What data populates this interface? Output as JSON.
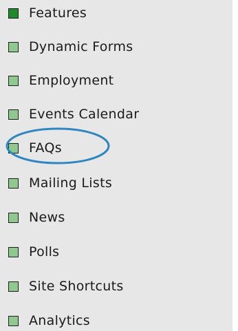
{
  "menu": {
    "items": [
      {
        "label": "Features",
        "state": "active"
      },
      {
        "label": "Dynamic Forms",
        "state": "inactive"
      },
      {
        "label": "Employment",
        "state": "inactive"
      },
      {
        "label": "Events Calendar",
        "state": "inactive"
      },
      {
        "label": "FAQs",
        "state": "inactive"
      },
      {
        "label": "Mailing Lists",
        "state": "inactive"
      },
      {
        "label": "News",
        "state": "inactive"
      },
      {
        "label": "Polls",
        "state": "inactive"
      },
      {
        "label": "Site Shortcuts",
        "state": "inactive"
      },
      {
        "label": "Analytics",
        "state": "inactive"
      }
    ]
  },
  "annotation": {
    "type": "ellipse",
    "target": "FAQs"
  },
  "colors": {
    "panel_background": "#e7e7e7",
    "active_bullet": "#1f8a2c",
    "inactive_bullet": "#8fc98f",
    "highlight_ellipse": "#2e86c1"
  }
}
